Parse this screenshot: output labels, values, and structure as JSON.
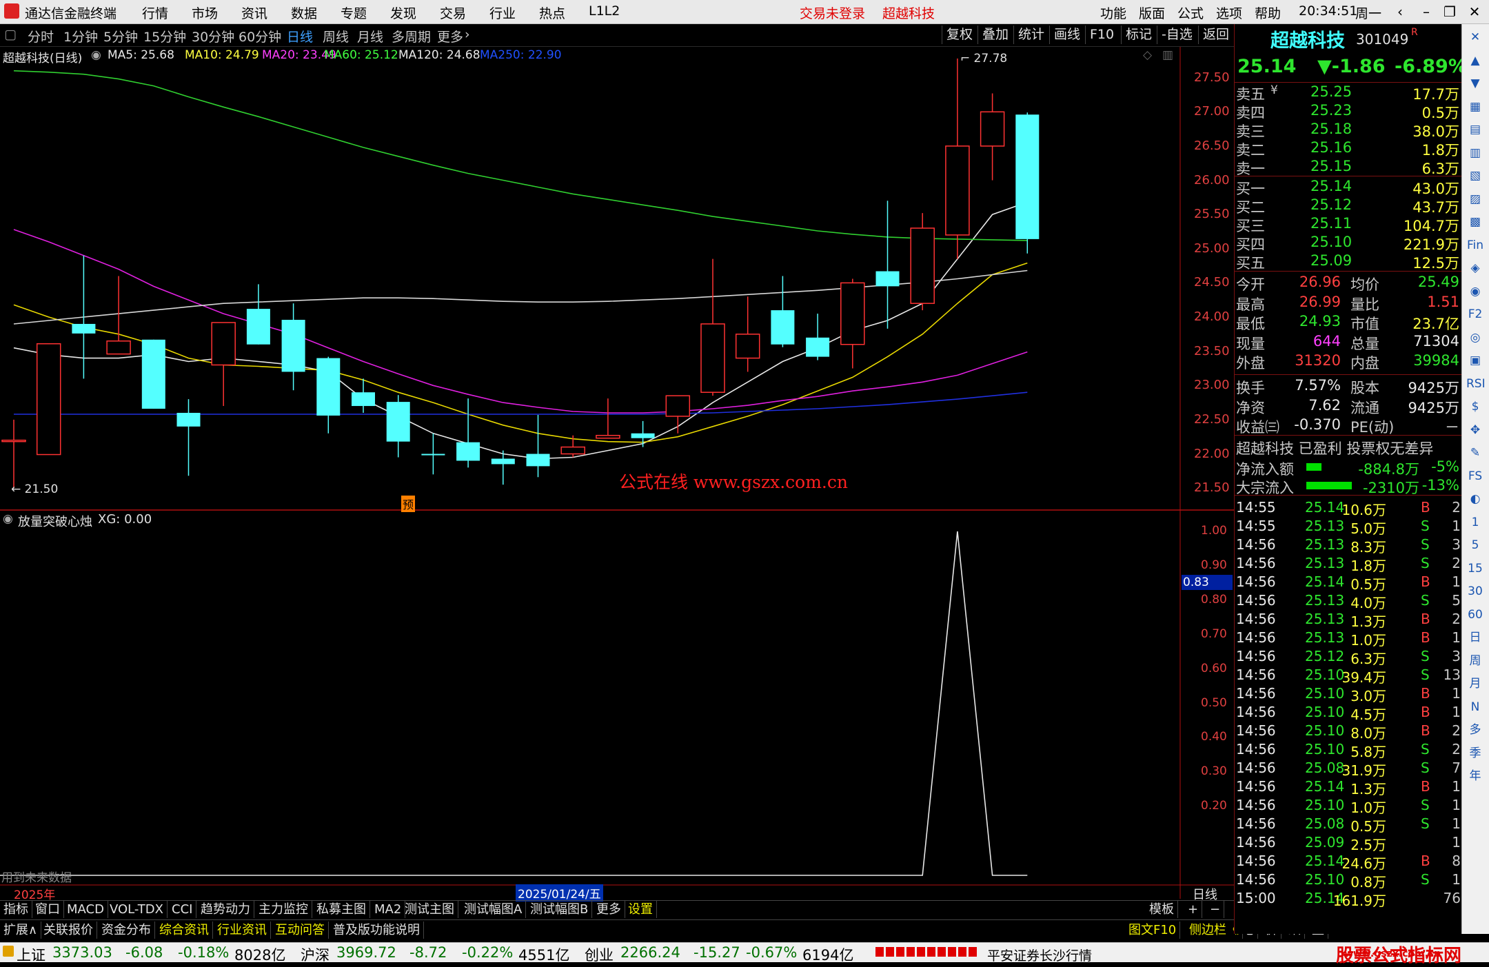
{
  "window": {
    "app_title": "通达信金融终端",
    "menu": [
      "行情",
      "市场",
      "资讯",
      "数据",
      "专题",
      "发现",
      "交易",
      "行业",
      "热点",
      "L1L2"
    ],
    "trade_status": "交易未登录",
    "active_stock": "超越科技",
    "right_menu": [
      "功能",
      "版面",
      "公式",
      "选项",
      "帮助"
    ],
    "time": "20:34:51",
    "weekday": "周一"
  },
  "period_bar": {
    "periods": [
      "分时",
      "1分钟",
      "5分钟",
      "15分钟",
      "30分钟",
      "60分钟",
      "日线",
      "周线",
      "月线",
      "多周期",
      "更多"
    ],
    "selected": "日线",
    "tools": [
      "复权",
      "叠加",
      "统计",
      "画线",
      "F10",
      "标记",
      "-自选",
      "返回"
    ]
  },
  "chart_header": {
    "title": "超越科技(日线)",
    "ma": [
      {
        "label": "MA5: 25.68",
        "color": "#e8e8e8"
      },
      {
        "label": "MA10: 24.79",
        "color": "#ffff40"
      },
      {
        "label": "MA20: 23.49",
        "color": "#ff40ff"
      },
      {
        "label": "MA60: 25.12",
        "color": "#40ff40"
      },
      {
        "label": "MA120: 24.68",
        "color": "#e8e8e8"
      },
      {
        "label": "MA250: 22.90",
        "color": "#2050ff"
      }
    ],
    "high_marker": "27.78",
    "low_marker": "21.50",
    "pre_marker": "预",
    "watermark": "公式在线  www.gszx.com.cn"
  },
  "chart_data": [
    {
      "type": "candlestick",
      "title": "超越科技(日线)",
      "y_axis_ticks": [
        "27.50",
        "27.00",
        "26.50",
        "26.00",
        "25.50",
        "25.00",
        "24.50",
        "24.00",
        "23.50",
        "23.00",
        "22.50",
        "22.00",
        "21.50"
      ],
      "ylim": [
        21.3,
        27.95
      ],
      "candles": [
        {
          "open": 22.2,
          "close": 22.2,
          "high": 22.5,
          "low": 21.5
        },
        {
          "open": 21.99,
          "close": 23.61,
          "high": 23.61,
          "low": 21.99
        },
        {
          "open": 23.9,
          "close": 23.76,
          "high": 24.9,
          "low": 23.1
        },
        {
          "open": 23.46,
          "close": 23.65,
          "high": 24.6,
          "low": 23.46
        },
        {
          "open": 23.67,
          "close": 22.66,
          "high": 23.67,
          "low": 22.66
        },
        {
          "open": 22.6,
          "close": 22.4,
          "high": 22.8,
          "low": 21.68
        },
        {
          "open": 23.3,
          "close": 23.92,
          "high": 23.92,
          "low": 22.7
        },
        {
          "open": 24.12,
          "close": 23.6,
          "high": 24.48,
          "low": 23.6
        },
        {
          "open": 23.96,
          "close": 23.2,
          "high": 24.2,
          "low": 22.93
        },
        {
          "open": 23.4,
          "close": 22.56,
          "high": 23.42,
          "low": 22.3
        },
        {
          "open": 22.9,
          "close": 22.7,
          "high": 23.1,
          "low": 22.6
        },
        {
          "open": 22.76,
          "close": 22.18,
          "high": 22.86,
          "low": 21.95
        },
        {
          "open": 22.0,
          "close": 21.99,
          "high": 22.3,
          "low": 21.7
        },
        {
          "open": 22.17,
          "close": 21.9,
          "high": 22.81,
          "low": 21.8
        },
        {
          "open": 21.93,
          "close": 21.85,
          "high": 22.05,
          "low": 21.55
        },
        {
          "open": 22.0,
          "close": 21.82,
          "high": 22.57,
          "low": 21.66
        },
        {
          "open": 22.0,
          "close": 22.1,
          "high": 22.27,
          "low": 21.95
        },
        {
          "open": 22.23,
          "close": 22.27,
          "high": 22.81,
          "low": 22.23
        },
        {
          "open": 22.3,
          "close": 22.23,
          "high": 22.48,
          "low": 22.1
        },
        {
          "open": 22.55,
          "close": 22.85,
          "high": 22.85,
          "low": 22.3
        },
        {
          "open": 22.9,
          "close": 23.9,
          "high": 24.85,
          "low": 22.85
        },
        {
          "open": 23.4,
          "close": 23.75,
          "high": 24.3,
          "low": 23.2
        },
        {
          "open": 24.1,
          "close": 23.6,
          "high": 24.6,
          "low": 23.56
        },
        {
          "open": 23.7,
          "close": 23.42,
          "high": 24.05,
          "low": 23.37
        },
        {
          "open": 23.6,
          "close": 24.5,
          "high": 24.56,
          "low": 23.25
        },
        {
          "open": 24.67,
          "close": 24.45,
          "high": 25.7,
          "low": 23.83
        },
        {
          "open": 24.2,
          "close": 25.3,
          "high": 25.52,
          "low": 24.1
        },
        {
          "open": 25.2,
          "close": 26.5,
          "high": 27.78,
          "low": 24.85
        },
        {
          "open": 26.5,
          "close": 27.0,
          "high": 27.27,
          "low": 26.0
        },
        {
          "open": 26.96,
          "close": 25.14,
          "high": 26.99,
          "low": 24.93
        }
      ],
      "ma_lines": {
        "MA5": [
          23.55,
          23.45,
          23.4,
          23.4,
          23.45,
          23.35,
          23.4,
          23.35,
          23.3,
          23.2,
          22.8,
          22.55,
          22.3,
          22.15,
          22.0,
          21.93,
          21.95,
          22.05,
          22.15,
          22.4,
          22.75,
          23.05,
          23.35,
          23.55,
          23.8,
          23.95,
          24.2,
          24.85,
          25.5,
          25.68
        ],
        "MA10": [
          24.18,
          24.0,
          23.85,
          23.75,
          23.6,
          23.4,
          23.3,
          23.28,
          23.25,
          23.22,
          23.08,
          22.9,
          22.75,
          22.58,
          22.42,
          22.3,
          22.22,
          22.18,
          22.17,
          22.25,
          22.4,
          22.55,
          22.72,
          22.92,
          23.12,
          23.42,
          23.75,
          24.2,
          24.62,
          24.79
        ],
        "MA20": [
          25.28,
          25.1,
          24.9,
          24.7,
          24.45,
          24.25,
          24.05,
          23.9,
          23.75,
          23.55,
          23.35,
          23.17,
          23.0,
          22.87,
          22.75,
          22.68,
          22.62,
          22.6,
          22.6,
          22.62,
          22.66,
          22.71,
          22.78,
          22.84,
          22.92,
          22.98,
          23.05,
          23.15,
          23.32,
          23.49
        ],
        "MA60": [
          27.6,
          27.58,
          27.55,
          27.48,
          27.38,
          27.22,
          27.07,
          26.93,
          26.78,
          26.63,
          26.48,
          26.35,
          26.22,
          26.1,
          26.0,
          25.9,
          25.8,
          25.72,
          25.64,
          25.56,
          25.47,
          25.4,
          25.33,
          25.26,
          25.21,
          25.17,
          25.15,
          25.14,
          25.13,
          25.12
        ],
        "MA120": [
          23.9,
          23.95,
          24.0,
          24.05,
          24.1,
          24.15,
          24.2,
          24.22,
          24.24,
          24.26,
          24.28,
          24.28,
          24.27,
          24.25,
          24.23,
          24.22,
          24.22,
          24.23,
          24.25,
          24.27,
          24.3,
          24.33,
          24.36,
          24.39,
          24.43,
          24.47,
          24.51,
          24.56,
          24.62,
          24.68
        ],
        "MA250": [
          22.58,
          22.58,
          22.58,
          22.58,
          22.58,
          22.58,
          22.58,
          22.58,
          22.58,
          22.58,
          22.58,
          22.58,
          22.58,
          22.58,
          22.58,
          22.58,
          22.58,
          22.58,
          22.58,
          22.59,
          22.6,
          22.62,
          22.64,
          22.66,
          22.69,
          22.72,
          22.76,
          22.8,
          22.85,
          22.9
        ]
      }
    },
    {
      "type": "line",
      "title": "放量突破心烛",
      "series": [
        {
          "name": "XG",
          "values": [
            0,
            0,
            0,
            0,
            0,
            0,
            0,
            0,
            0,
            0,
            0,
            0,
            0,
            0,
            0,
            0,
            0,
            0,
            0,
            0,
            0,
            0,
            0,
            0,
            0,
            0,
            0,
            1,
            0,
            0
          ]
        }
      ],
      "y_axis_ticks": [
        "1.00",
        "0.90",
        "0.80",
        "0.70",
        "0.60",
        "0.50",
        "0.40",
        "0.30",
        "0.20"
      ],
      "ylim": [
        0,
        1.0
      ],
      "current_value": "0.83"
    }
  ],
  "indicator_header": {
    "name": "放量突破心烛",
    "value": "XG: 0.00",
    "note": "用到未来数据"
  },
  "x_axis": {
    "year": "2025年",
    "cursor_date": "2025/01/24/五",
    "period": "日线"
  },
  "quote_panel": {
    "name": "超越科技",
    "code": "301049",
    "flag": "R",
    "price": "25.14",
    "change": "▼-1.86",
    "pct": "-6.89%",
    "asks": [
      {
        "label": "卖五",
        "price": "25.25",
        "vol": "17.7万"
      },
      {
        "label": "卖四",
        "price": "25.23",
        "vol": "0.5万"
      },
      {
        "label": "卖三",
        "price": "25.18",
        "vol": "38.0万"
      },
      {
        "label": "卖二",
        "price": "25.16",
        "vol": "1.8万"
      },
      {
        "label": "卖一",
        "price": "25.15",
        "vol": "6.3万"
      }
    ],
    "ask_symbol": "¥",
    "bids": [
      {
        "label": "买一",
        "price": "25.14",
        "vol": "43.0万"
      },
      {
        "label": "买二",
        "price": "25.12",
        "vol": "43.7万"
      },
      {
        "label": "买三",
        "price": "25.11",
        "vol": "104.7万"
      },
      {
        "label": "买四",
        "price": "25.10",
        "vol": "221.9万"
      },
      {
        "label": "买五",
        "price": "25.09",
        "vol": "12.5万"
      }
    ],
    "stats": [
      {
        "l1": "今开",
        "v1": "26.96",
        "l2": "均价",
        "v2": "25.49"
      },
      {
        "l1": "最高",
        "v1": "26.99",
        "l2": "量比",
        "v2": "1.51"
      },
      {
        "l1": "最低",
        "v1": "24.93",
        "l2": "市值",
        "v2": "23.7亿"
      },
      {
        "l1": "现量",
        "v1": "644",
        "l2": "总量",
        "v2": "71304"
      },
      {
        "l1": "外盘",
        "v1": "31320",
        "l2": "内盘",
        "v2": "39984"
      }
    ],
    "fund": [
      {
        "l1": "换手",
        "v1": "7.57%",
        "l2": "股本",
        "v2": "9425万"
      },
      {
        "l1": "净资",
        "v1": "7.62",
        "l2": "流通",
        "v2": "9425万"
      },
      {
        "l1": "收益㈢",
        "v1": "-0.370",
        "l2": "PE(动)",
        "v2": "－"
      }
    ],
    "tags": "超越科技 已盈利 投票权无差异",
    "flows": [
      {
        "label": "净流入额",
        "value": "-884.8万",
        "pct": "-5%"
      },
      {
        "label": "大宗流入",
        "value": "-2310万",
        "pct": "-13%"
      }
    ]
  },
  "ticks": [
    {
      "t": "14:55",
      "p": "25.14",
      "v": "10.6万",
      "s": "B",
      "n": "2"
    },
    {
      "t": "14:55",
      "p": "25.13",
      "v": "5.0万",
      "s": "S",
      "n": "1"
    },
    {
      "t": "14:56",
      "p": "25.13",
      "v": "8.3万",
      "s": "S",
      "n": "3"
    },
    {
      "t": "14:56",
      "p": "25.13",
      "v": "1.8万",
      "s": "S",
      "n": "2"
    },
    {
      "t": "14:56",
      "p": "25.14",
      "v": "0.5万",
      "s": "B",
      "n": "1"
    },
    {
      "t": "14:56",
      "p": "25.13",
      "v": "4.0万",
      "s": "S",
      "n": "5"
    },
    {
      "t": "14:56",
      "p": "25.13",
      "v": "1.3万",
      "s": "B",
      "n": "2"
    },
    {
      "t": "14:56",
      "p": "25.13",
      "v": "1.0万",
      "s": "B",
      "n": "1"
    },
    {
      "t": "14:56",
      "p": "25.12",
      "v": "6.3万",
      "s": "S",
      "n": "3"
    },
    {
      "t": "14:56",
      "p": "25.10",
      "v": "39.4万",
      "s": "S",
      "n": "13"
    },
    {
      "t": "14:56",
      "p": "25.10",
      "v": "3.0万",
      "s": "B",
      "n": "1"
    },
    {
      "t": "14:56",
      "p": "25.10",
      "v": "4.5万",
      "s": "B",
      "n": "1"
    },
    {
      "t": "14:56",
      "p": "25.10",
      "v": "8.0万",
      "s": "B",
      "n": "2"
    },
    {
      "t": "14:56",
      "p": "25.10",
      "v": "5.8万",
      "s": "S",
      "n": "2"
    },
    {
      "t": "14:56",
      "p": "25.08",
      "v": "31.9万",
      "s": "S",
      "n": "7"
    },
    {
      "t": "14:56",
      "p": "25.14",
      "v": "1.3万",
      "s": "B",
      "n": "1"
    },
    {
      "t": "14:56",
      "p": "25.10",
      "v": "1.0万",
      "s": "S",
      "n": "1"
    },
    {
      "t": "14:56",
      "p": "25.08",
      "v": "0.5万",
      "s": "S",
      "n": "1"
    },
    {
      "t": "14:56",
      "p": "25.09",
      "v": "2.5万",
      "s": "",
      "n": "1"
    },
    {
      "t": "14:56",
      "p": "25.14",
      "v": "24.6万",
      "s": "B",
      "n": "8"
    },
    {
      "t": "14:56",
      "p": "25.10",
      "v": "0.8万",
      "s": "S",
      "n": "1"
    },
    {
      "t": "15:00",
      "p": "25.14",
      "v": "161.9万",
      "s": "",
      "n": "76"
    }
  ],
  "bottom_tabs": [
    "指标",
    "窗口",
    "MACD",
    "VOL-TDX",
    "CCI",
    "趋势动力",
    "主力监控",
    "私募主图",
    "MA2",
    "测试主图",
    "测试幅图A",
    "测试幅图B",
    "更多",
    "设置"
  ],
  "bottom_right": [
    "模板",
    "+",
    "−"
  ],
  "info_tabs": [
    "扩展∧",
    "关联报价",
    "资金分布",
    "综合资讯",
    "行业资讯",
    "互动问答",
    "普及版功能说明"
  ],
  "right_tabs": [
    "图文F10",
    "侧边栏《",
    "笔",
    "价",
    "细",
    "盘"
  ],
  "side_toolbar": [
    "✕",
    "▲",
    "▼",
    "▦",
    "▤",
    "▥",
    "▧",
    "▨",
    "▩",
    "Fin",
    "◈",
    "◉",
    "F2",
    "◎",
    "▣",
    "RSI",
    "$",
    "✥",
    "✎",
    "FS",
    "◐",
    "1",
    "5",
    "15",
    "30",
    "60",
    "日",
    "周",
    "月",
    "N",
    "多",
    "季",
    "年"
  ],
  "status": {
    "indices": [
      {
        "name": "上证",
        "value": "3373.03",
        "chg": "-6.08",
        "pct": "-0.18%",
        "amt": "8028亿"
      },
      {
        "name": "沪深",
        "value": "3969.72",
        "chg": "-8.72",
        "pct": "-0.22%",
        "amt": "4551亿"
      },
      {
        "name": "创业",
        "value": "2266.24",
        "chg": "-15.27",
        "pct": "-0.67%",
        "amt": "6194亿"
      }
    ],
    "broker": "平安证券长沙行情",
    "brand": "股票公式指标网",
    "brand_url": "www.gszx.com.cn"
  }
}
